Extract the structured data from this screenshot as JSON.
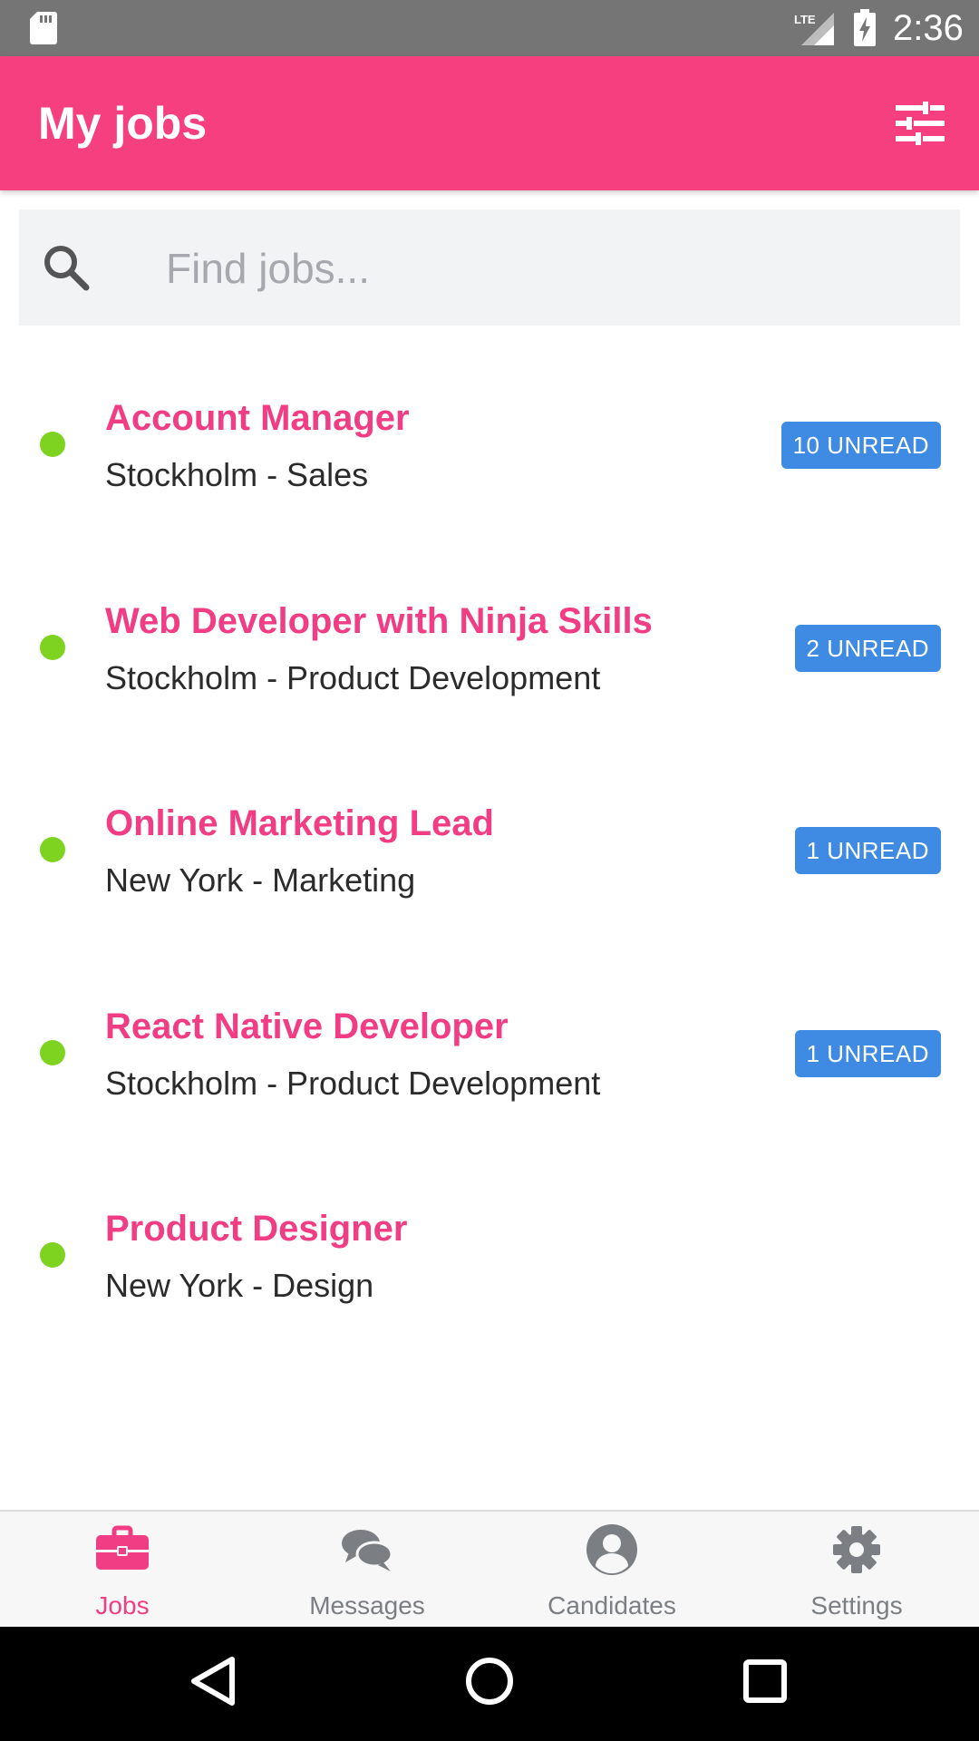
{
  "status_bar": {
    "time": "2:36",
    "network_label": "LTE",
    "icons": [
      "sd-card-icon",
      "signal-icon",
      "battery-charging-icon"
    ]
  },
  "header": {
    "title": "My jobs",
    "filter_icon": "sliders-icon"
  },
  "search": {
    "placeholder": "Find jobs...",
    "value": "",
    "icon": "search-icon"
  },
  "jobs": [
    {
      "title": "Account Manager",
      "subtitle": "Stockholm - Sales",
      "badge": "10 UNREAD",
      "status": "active"
    },
    {
      "title": "Web Developer with Ninja Skills",
      "subtitle": "Stockholm - Product Development",
      "badge": "2 UNREAD",
      "status": "active"
    },
    {
      "title": "Online Marketing Lead",
      "subtitle": "New York - Marketing",
      "badge": "1 UNREAD",
      "status": "active"
    },
    {
      "title": "React Native Developer",
      "subtitle": "Stockholm - Product Development",
      "badge": "1 UNREAD",
      "status": "active"
    },
    {
      "title": "Product Designer",
      "subtitle": "New York - Design",
      "badge": "",
      "status": "active"
    }
  ],
  "bottom_nav": {
    "active": "Jobs",
    "items": [
      {
        "label": "Jobs",
        "icon": "briefcase-icon"
      },
      {
        "label": "Messages",
        "icon": "chat-bubbles-icon"
      },
      {
        "label": "Candidates",
        "icon": "user-circle-icon"
      },
      {
        "label": "Settings",
        "icon": "gear-icon"
      }
    ]
  },
  "system_nav": [
    "back-icon",
    "home-icon",
    "recents-icon"
  ],
  "colors": {
    "primary": "#f53f7f",
    "title_pink": "#f03d83",
    "badge_blue": "#3f8be3",
    "status_dot_green": "#7ed321",
    "status_bar_gray": "#757575"
  }
}
